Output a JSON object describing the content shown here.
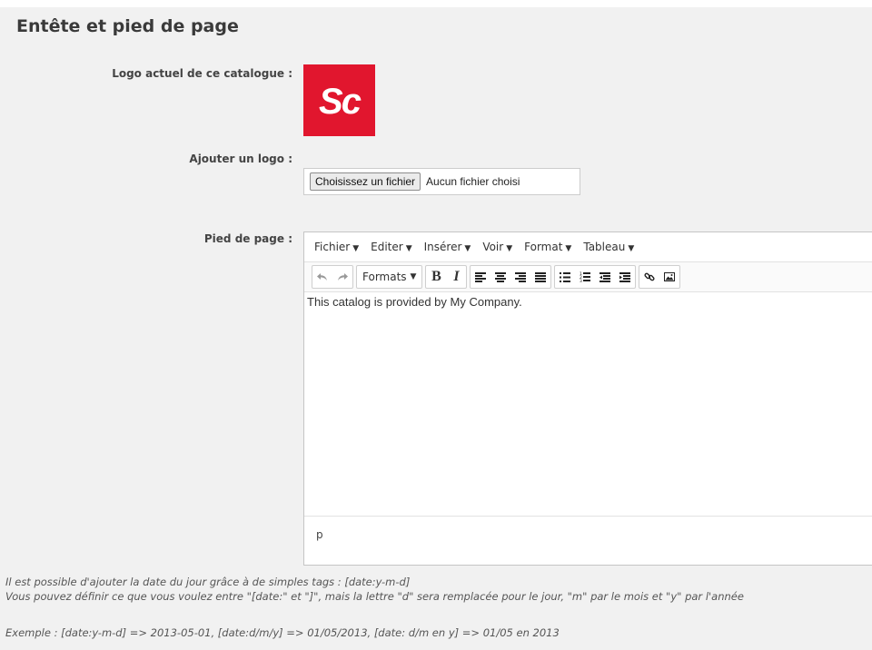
{
  "section": {
    "title": "Entête et pied de page"
  },
  "current_logo": {
    "label": "Logo actuel de ce catalogue :",
    "logo_text": "Sc",
    "logo_color": "#e1162e"
  },
  "add_logo": {
    "label": "Ajouter un logo :",
    "button_label": "Choisissez un fichier",
    "status": "Aucun fichier choisi"
  },
  "footer": {
    "label": "Pied de page :",
    "menu": [
      "Fichier",
      "Editer",
      "Insérer",
      "Voir",
      "Format",
      "Tableau"
    ],
    "toolbar": {
      "formats_label": "Formats",
      "bold": "B",
      "italic": "I",
      "icons": [
        "undo-icon",
        "redo-icon",
        "align-left-icon",
        "align-center-icon",
        "align-right-icon",
        "align-justify-icon",
        "bullet-list-icon",
        "numbered-list-icon",
        "outdent-icon",
        "indent-icon",
        "link-icon",
        "image-icon"
      ]
    },
    "content": "This catalog is provided by My Company.",
    "status_path": "p"
  },
  "help": {
    "line1": "Il est possible d'ajouter la date du jour grâce à de simples tags : [date:y-m-d]",
    "line2": "Vous pouvez définir ce que vous voulez entre \"[date:\" et \"]\", mais la lettre \"d\" sera remplacée pour le jour, \"m\" par le mois et \"y\" par l'année",
    "example": "Exemple : [date:y-m-d] => 2013-05-01, [date:d/m/y] => 01/05/2013, [date: d/m en y] => 01/05 en 2013"
  }
}
